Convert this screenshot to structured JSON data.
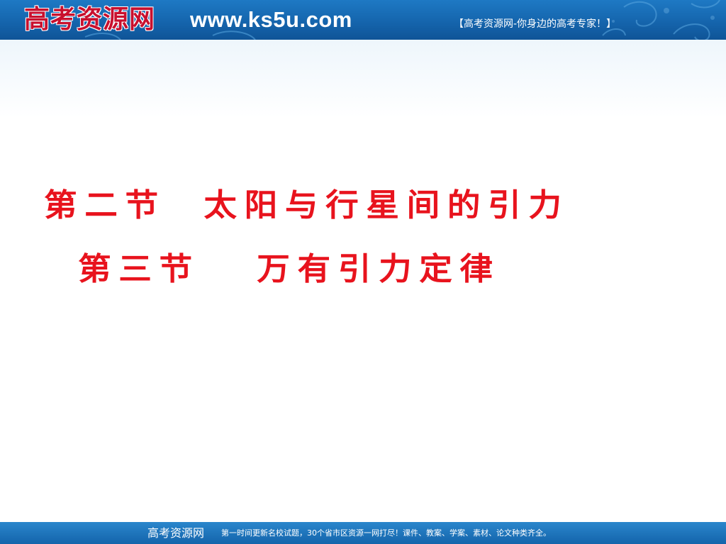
{
  "header": {
    "logo_text": "高考资源网",
    "url": "www.ks5u.com",
    "slogan": "【高考资源网-你身边的高考专家！】"
  },
  "slide": {
    "title_line_1": "第二节  太阳与行星间的引力",
    "title_line_2": "第三节   万有引力定律"
  },
  "footer": {
    "brand": "高考资源网",
    "text": "第一时间更新名校试题，30个省市区资源一网打尽！课件、教案、学案、素材、论文种类齐全。"
  },
  "colors": {
    "header_blue": "#1565ad",
    "title_red": "#e8131d",
    "logo_red": "#c8102e"
  }
}
